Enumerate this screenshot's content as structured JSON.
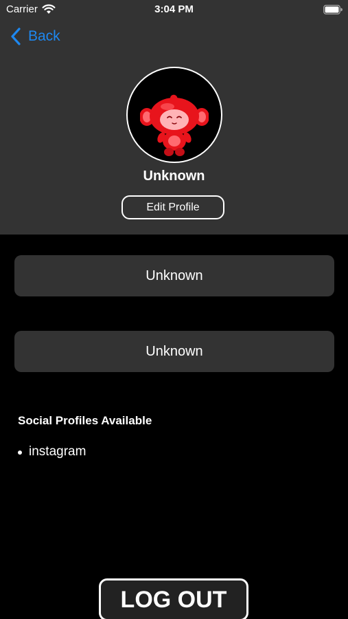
{
  "status_bar": {
    "carrier": "Carrier",
    "time": "3:04 PM",
    "wifi_icon": "wifi-icon",
    "battery_icon": "battery-icon"
  },
  "nav": {
    "back_label": "Back",
    "back_icon": "chevron-left-icon",
    "accent_color": "#1e88f0"
  },
  "profile": {
    "avatar_icon": "red-monkey-mascot",
    "name": "Unknown",
    "edit_label": "Edit Profile"
  },
  "fields": [
    {
      "value": "Unknown"
    },
    {
      "value": "Unknown"
    }
  ],
  "social": {
    "title": "Social Profiles Available",
    "items": [
      "instagram"
    ]
  },
  "logout_label": "LOG OUT",
  "colors": {
    "header_bg": "#333333",
    "page_bg": "#000000",
    "field_bg": "#333333",
    "mascot_red": "#e8141c"
  }
}
